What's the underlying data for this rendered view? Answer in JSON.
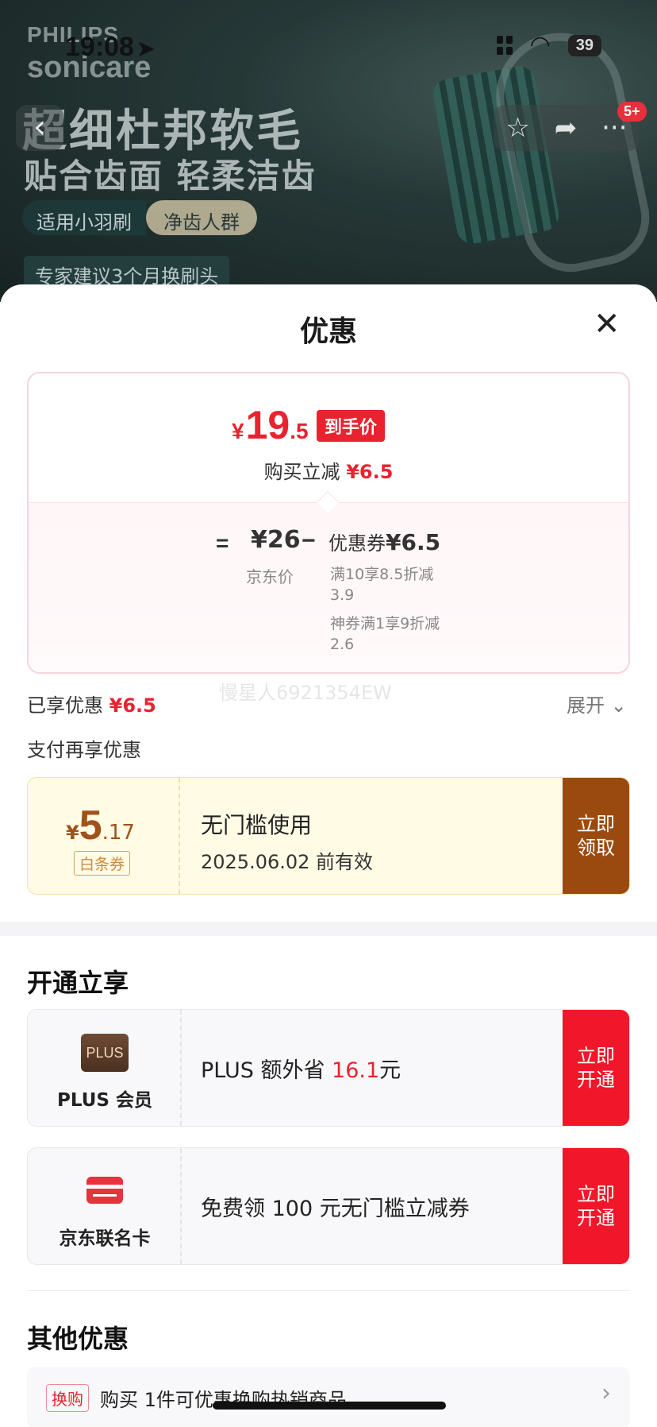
{
  "status_bar": {
    "time": "19:08",
    "battery": "39"
  },
  "hero": {
    "brand_line1": "PHILIPS",
    "brand_line2": "sonicare",
    "title": "超细杜邦软毛",
    "subtitle": "贴合齿面 轻柔洁齿",
    "pill_left": "适用小羽刷",
    "pill_right": "净齿人群",
    "tip": "专家建议3个月换刷头",
    "message_badge": "5+"
  },
  "sheet": {
    "title": "优惠",
    "price": {
      "currency": "¥",
      "integer": "19",
      "decimal": ".5",
      "tag": "到手价",
      "reduce_label": "购买立减",
      "reduce_value": "¥6.5",
      "equals": "=",
      "jd_price": "¥26",
      "jd_label": "京东价",
      "minus": "−",
      "coupon_label": "优惠券",
      "coupon_value": "¥6.5",
      "detail1": "满10享8.5折减3.9",
      "detail2": "神券满1享9折减2.6"
    },
    "watermark": "慢星人6921354EW",
    "enjoyed_label": "已享优惠",
    "enjoyed_value": "¥6.5",
    "expand_label": "展开",
    "pay_more_label": "支付再享优惠",
    "baitiao": {
      "currency": "¥",
      "integer": "5",
      "decimal": ".17",
      "tag": "白条券",
      "title": "无门槛使用",
      "validity": "2025.06.02 前有效",
      "button": "立即领取"
    },
    "open_section_title": "开通立享",
    "plus": {
      "logo": "PLUS",
      "name": "PLUS 会员",
      "text_prefix": "PLUS 额外省 ",
      "amount": "16.1",
      "text_suffix": "元",
      "button": "立即开通"
    },
    "card": {
      "name": "京东联名卡",
      "text": "免费领 100 元无门槛立减券",
      "button": "立即开通"
    },
    "other_section_title": "其他优惠",
    "other": {
      "tag": "换购",
      "text": "购买 1件可优惠换购热销商品"
    }
  },
  "icons": [
    "arrow-icon",
    "signal-icon",
    "wifi-icon",
    "back-icon",
    "star-icon",
    "share-icon",
    "more-icon",
    "close-icon",
    "chevron-down-icon",
    "chevron-right-icon",
    "plus-logo-icon",
    "credit-card-icon"
  ],
  "colors": {
    "accent_red": "#e8232f",
    "baitiao_brown": "#9b4a0f",
    "open_button_red": "#f1162a"
  }
}
